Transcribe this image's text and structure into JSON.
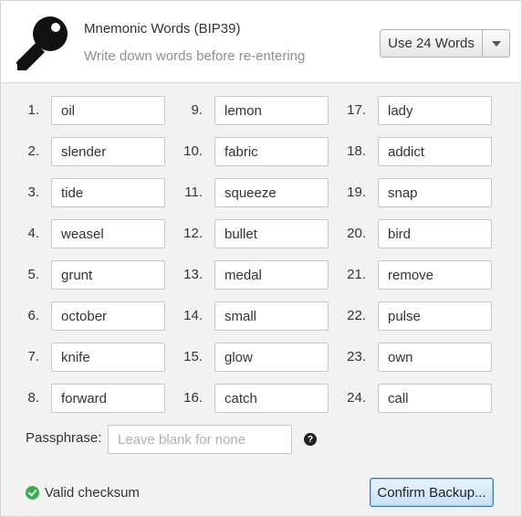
{
  "header": {
    "title": "Mnemonic Words (BIP39)",
    "subtitle": "Write down words before re-entering",
    "icon": "key-icon",
    "word_count_select": {
      "selected": "Use 24 Words"
    }
  },
  "words": [
    {
      "num": "1.",
      "value": "oil"
    },
    {
      "num": "2.",
      "value": "slender"
    },
    {
      "num": "3.",
      "value": "tide"
    },
    {
      "num": "4.",
      "value": "weasel"
    },
    {
      "num": "5.",
      "value": "grunt"
    },
    {
      "num": "6.",
      "value": "october"
    },
    {
      "num": "7.",
      "value": "knife"
    },
    {
      "num": "8.",
      "value": "forward"
    },
    {
      "num": "9.",
      "value": "lemon"
    },
    {
      "num": "10.",
      "value": "fabric"
    },
    {
      "num": "11.",
      "value": "squeeze"
    },
    {
      "num": "12.",
      "value": "bullet"
    },
    {
      "num": "13.",
      "value": "medal"
    },
    {
      "num": "14.",
      "value": "small"
    },
    {
      "num": "15.",
      "value": "glow"
    },
    {
      "num": "16.",
      "value": "catch"
    },
    {
      "num": "17.",
      "value": "lady"
    },
    {
      "num": "18.",
      "value": "addict"
    },
    {
      "num": "19.",
      "value": "snap"
    },
    {
      "num": "20.",
      "value": "bird"
    },
    {
      "num": "21.",
      "value": "remove"
    },
    {
      "num": "22.",
      "value": "pulse"
    },
    {
      "num": "23.",
      "value": "own"
    },
    {
      "num": "24.",
      "value": "call"
    }
  ],
  "passphrase": {
    "label": "Passphrase:",
    "value": "",
    "placeholder": "Leave blank for none",
    "help_icon": "question-circle-icon"
  },
  "status": {
    "icon": "check-circle-icon",
    "text": "Valid checksum",
    "color": "#3cae4f"
  },
  "actions": {
    "confirm_label": "Confirm Backup..."
  }
}
